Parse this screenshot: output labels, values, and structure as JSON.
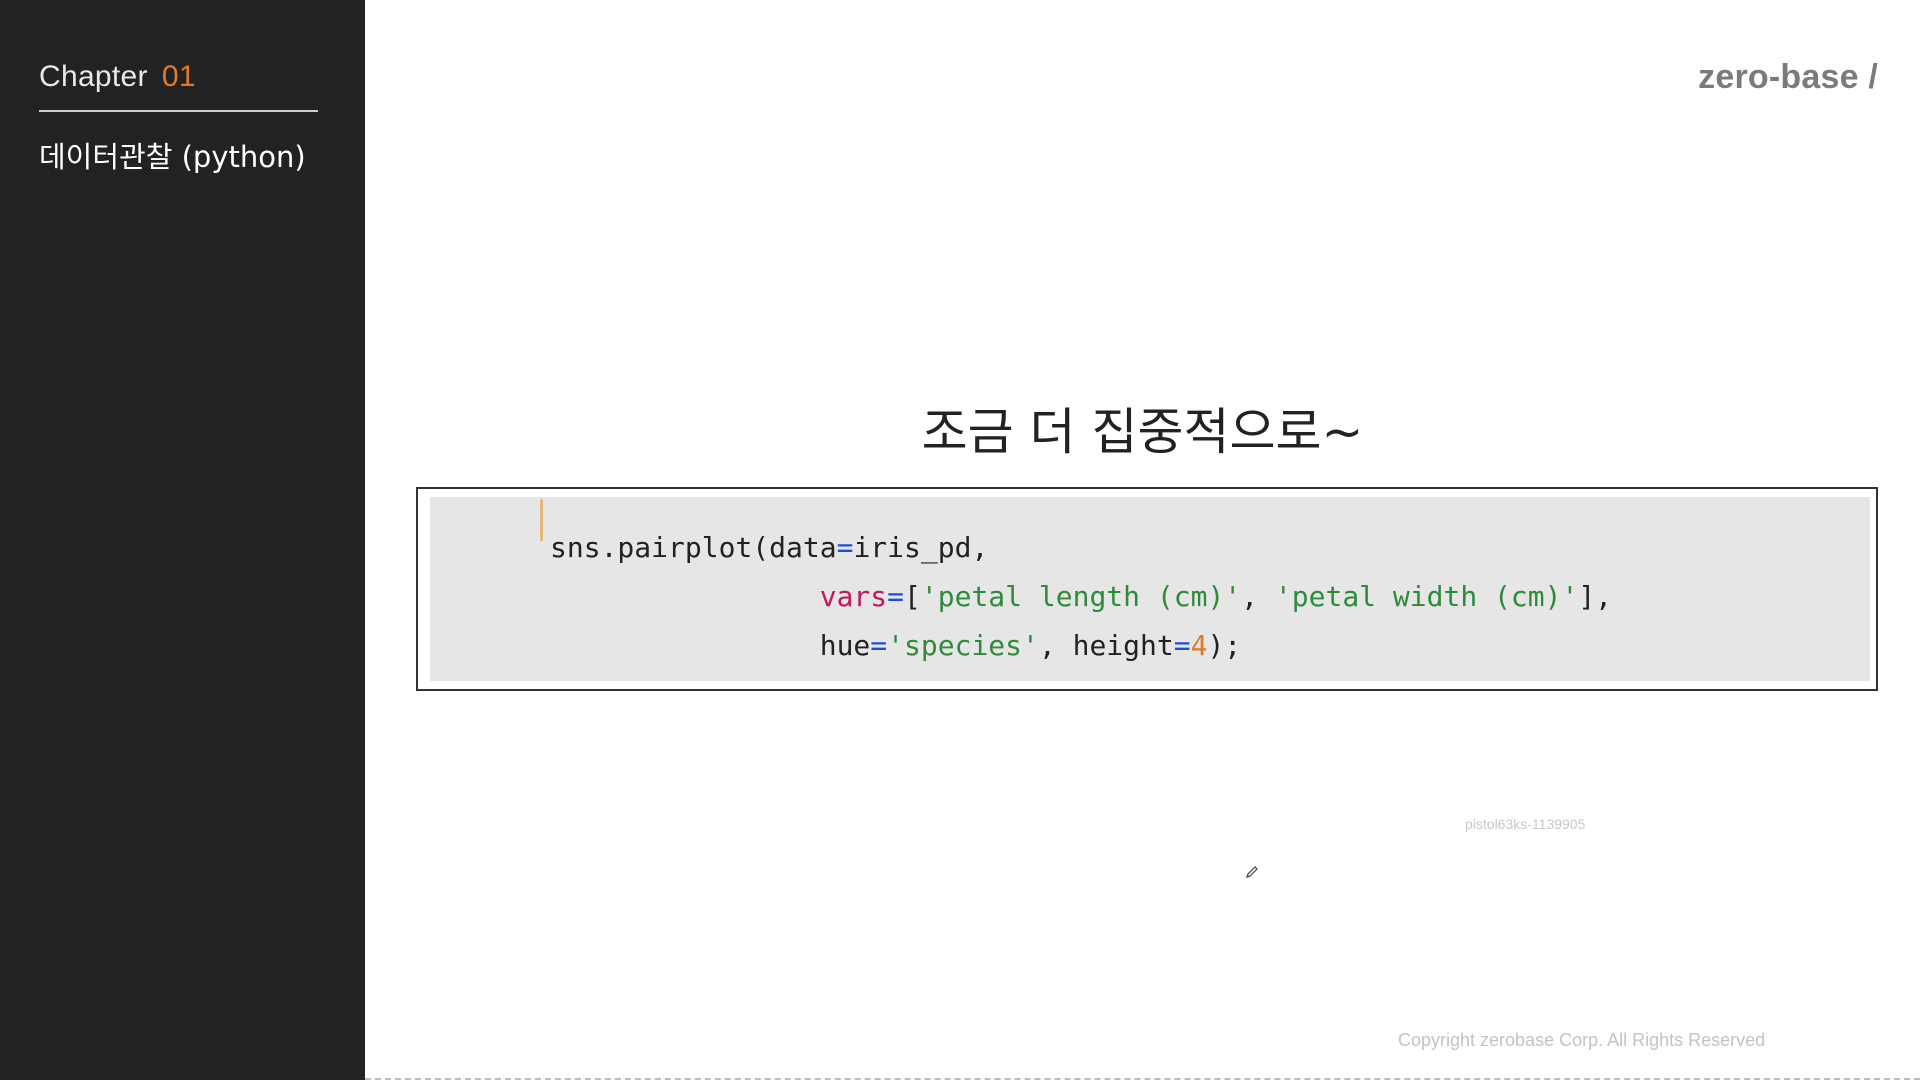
{
  "sidebar": {
    "chapter_label": "Chapter",
    "chapter_number": "01",
    "title": "데이터관찰 (python)"
  },
  "logo": {
    "text": "zero-base /"
  },
  "slide": {
    "heading": "조금 더 집중적으로~"
  },
  "code": {
    "line1_call": "sns.pairplot(data",
    "line1_eq": "=",
    "line1_arg": "iris_pd,",
    "indent": "                ",
    "line2_kw": "vars",
    "line2_eq": "=",
    "line2_open": "[",
    "line2_str1": "'petal length (cm)'",
    "line2_sep": ", ",
    "line2_str2": "'petal width (cm)'",
    "line2_close": "],",
    "line3_kw": "hue",
    "line3_eq": "=",
    "line3_str": "'species'",
    "line3_sep": ", height",
    "line3_eq2": "=",
    "line3_num": "4",
    "line3_close": ");"
  },
  "watermark": "pistol63ks-1139905",
  "footer": {
    "copyright": "Copyright zerobase Corp. All Rights Reserved"
  },
  "colors": {
    "sidebar_bg": "#222222",
    "keyword": "#c2185b",
    "string": "#2e8b3a",
    "number": "#e07a2a",
    "operator": "#1f4fd1"
  },
  "icons": {
    "pencil": "pencil-icon"
  }
}
